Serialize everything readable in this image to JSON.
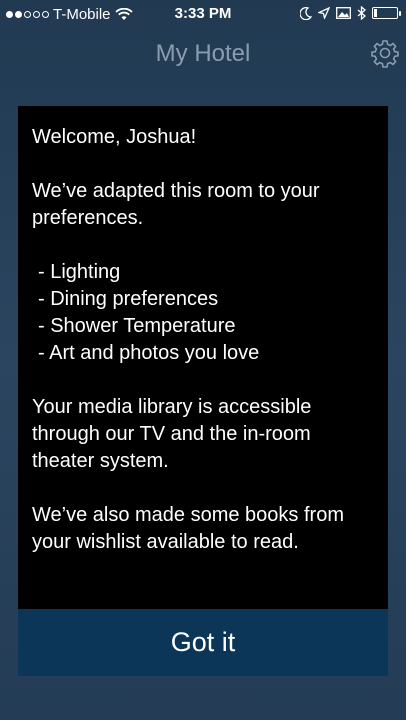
{
  "status_bar": {
    "carrier": "T-Mobile",
    "signal_filled": 2,
    "signal_total": 5,
    "time": "3:33 PM",
    "battery_level": 0.15
  },
  "nav": {
    "title": "My Hotel",
    "settings_icon": "gear-icon"
  },
  "message": {
    "greeting": "Welcome, Joshua!",
    "intro": "We’ve adapted this room to your preferences.",
    "items": [
      "Lighting",
      "Dining preferences",
      "Shower Temperature",
      "Art and photos you love"
    ],
    "media": "Your media library is accessible through our TV and the in-room theater system.",
    "books": "We’ve also made some books from your wishlist available to read."
  },
  "actions": {
    "confirm_label": "Got it"
  }
}
